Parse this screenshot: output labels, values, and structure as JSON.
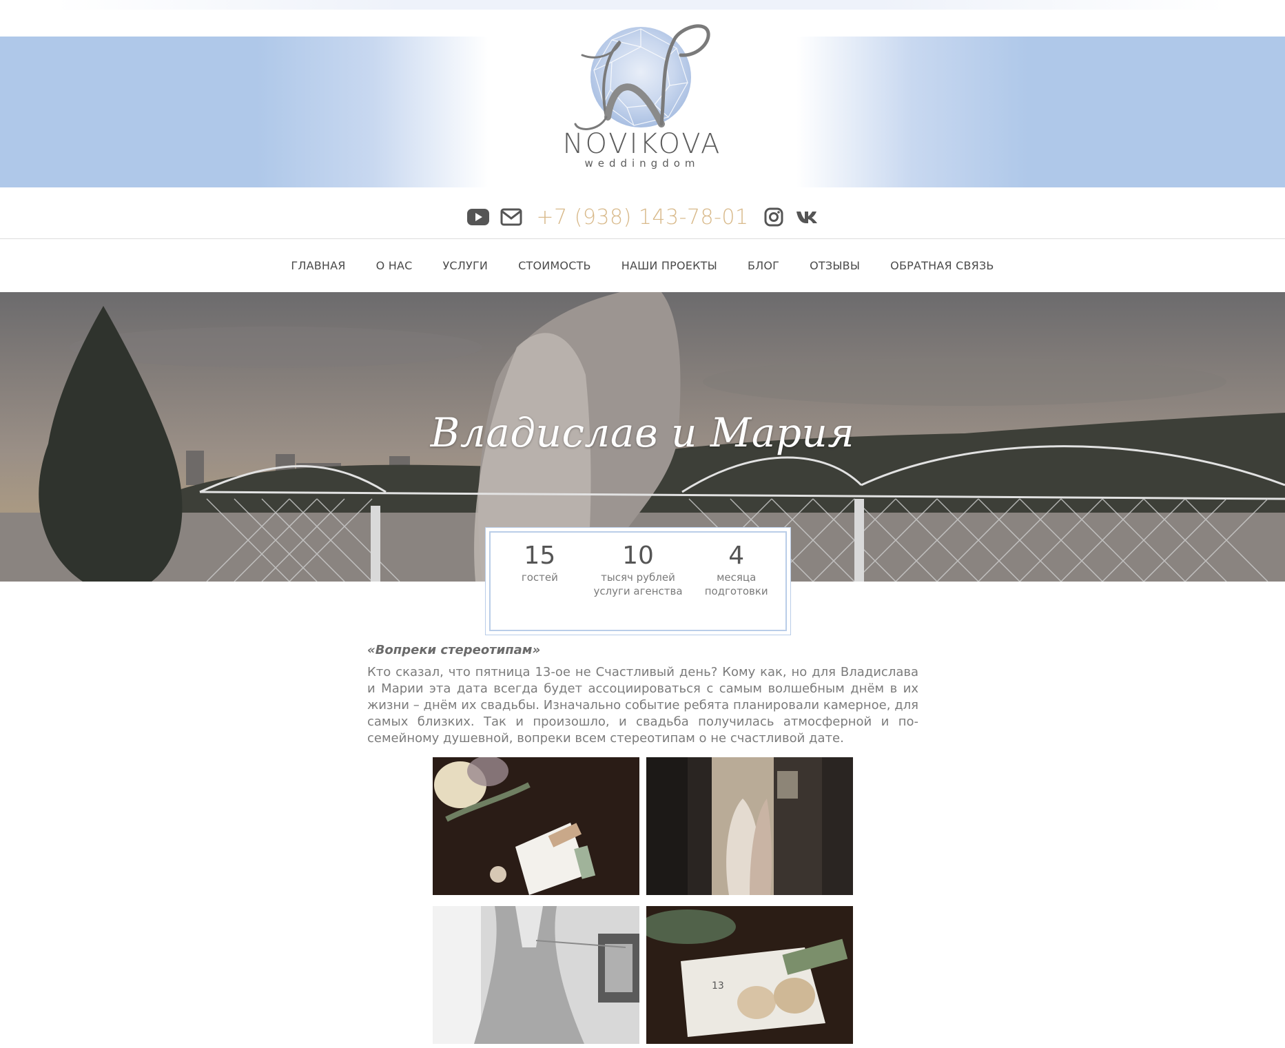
{
  "brand": {
    "name": "NOVIKOVA",
    "tagline": "weddingdom"
  },
  "contact": {
    "phone": "+7 (938) 143-78-01",
    "icons": [
      "youtube-icon",
      "mail-icon",
      "instagram-icon",
      "vk-icon"
    ]
  },
  "nav": {
    "items": [
      "ГЛАВНАЯ",
      "О НАС",
      "УСЛУГИ",
      "СТОИМОСТЬ",
      "НАШИ ПРОЕКТЫ",
      "БЛОГ",
      "ОТЗЫВЫ",
      "ОБРАТНАЯ СВЯЗЬ"
    ]
  },
  "hero": {
    "title": "Владислав и Мария"
  },
  "stats": [
    {
      "number": "15",
      "label_1": "гостей",
      "label_2": ""
    },
    {
      "number": "10",
      "label_1": "тысяч рублей",
      "label_2": "услуги агенства"
    },
    {
      "number": "4",
      "label_1": "месяца",
      "label_2": "подготовки"
    }
  ],
  "article": {
    "heading": "«Вопреки стереотипам»",
    "text": "Кто сказал, что пятница 13-ое не Счастливый день? Кому как, но для Владислава и Марии эта дата всегда будет ассоциироваться с самым волшебным днём в их жизни – днём их свадьбы. Изначально событие ребята планировали камерное, для самых близких. Так и произошло, и свадьба получилась атмосферной и по-семейному душевной, вопреки всем стереотипам о не счастливой дате."
  },
  "colors": {
    "banner_blue": "#afc8e9",
    "phone_gold": "#d8b98a",
    "frame_blue": "#b9cde8",
    "text_gray": "#7b7b7b"
  }
}
